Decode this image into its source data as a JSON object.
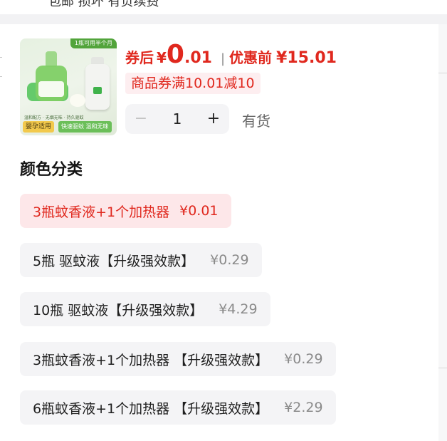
{
  "header": {
    "partial_text": "包邮 损坏 有负续费"
  },
  "product": {
    "image": {
      "badge": "1瓶可用半个月",
      "tag_left": "婴孕适用",
      "tag_right": "快速驱蚊 温和无味",
      "fine_print": "温和配方 · 无烟无味 · 持久驱蚊"
    },
    "price": {
      "after_coupon_label": "券后",
      "currency": "¥",
      "after_coupon_int": "0",
      "after_coupon_dec": ".01",
      "separator": "|",
      "before_label": "优惠前",
      "before_value": "¥15.01"
    },
    "coupon_text": "商品券满10.01减10",
    "quantity": {
      "minus": "−",
      "value": "1",
      "plus": "+"
    },
    "stock_text": "有货"
  },
  "options": {
    "title": "颜色分类",
    "items": [
      {
        "name": "3瓶蚊香液+1个加热器",
        "price": "¥0.01",
        "selected": true
      },
      {
        "name": "5瓶 驱蚊液【升级强效款】",
        "price": "¥0.29",
        "selected": false
      },
      {
        "name": "10瓶 驱蚊液【升级强效款】",
        "price": "¥4.29",
        "selected": false
      },
      {
        "name": "3瓶蚊香液+1个加热器 【升级强效款】",
        "price": "¥0.29",
        "selected": false
      },
      {
        "name": "6瓶蚊香液+1个加热器 【升级强效款】",
        "price": "¥2.29",
        "selected": false
      }
    ]
  },
  "colors": {
    "accent_red": "#e0281e",
    "selected_bg": "#fde7e9",
    "chip_bg": "#f4f4f6",
    "muted": "#8a8a8a"
  }
}
